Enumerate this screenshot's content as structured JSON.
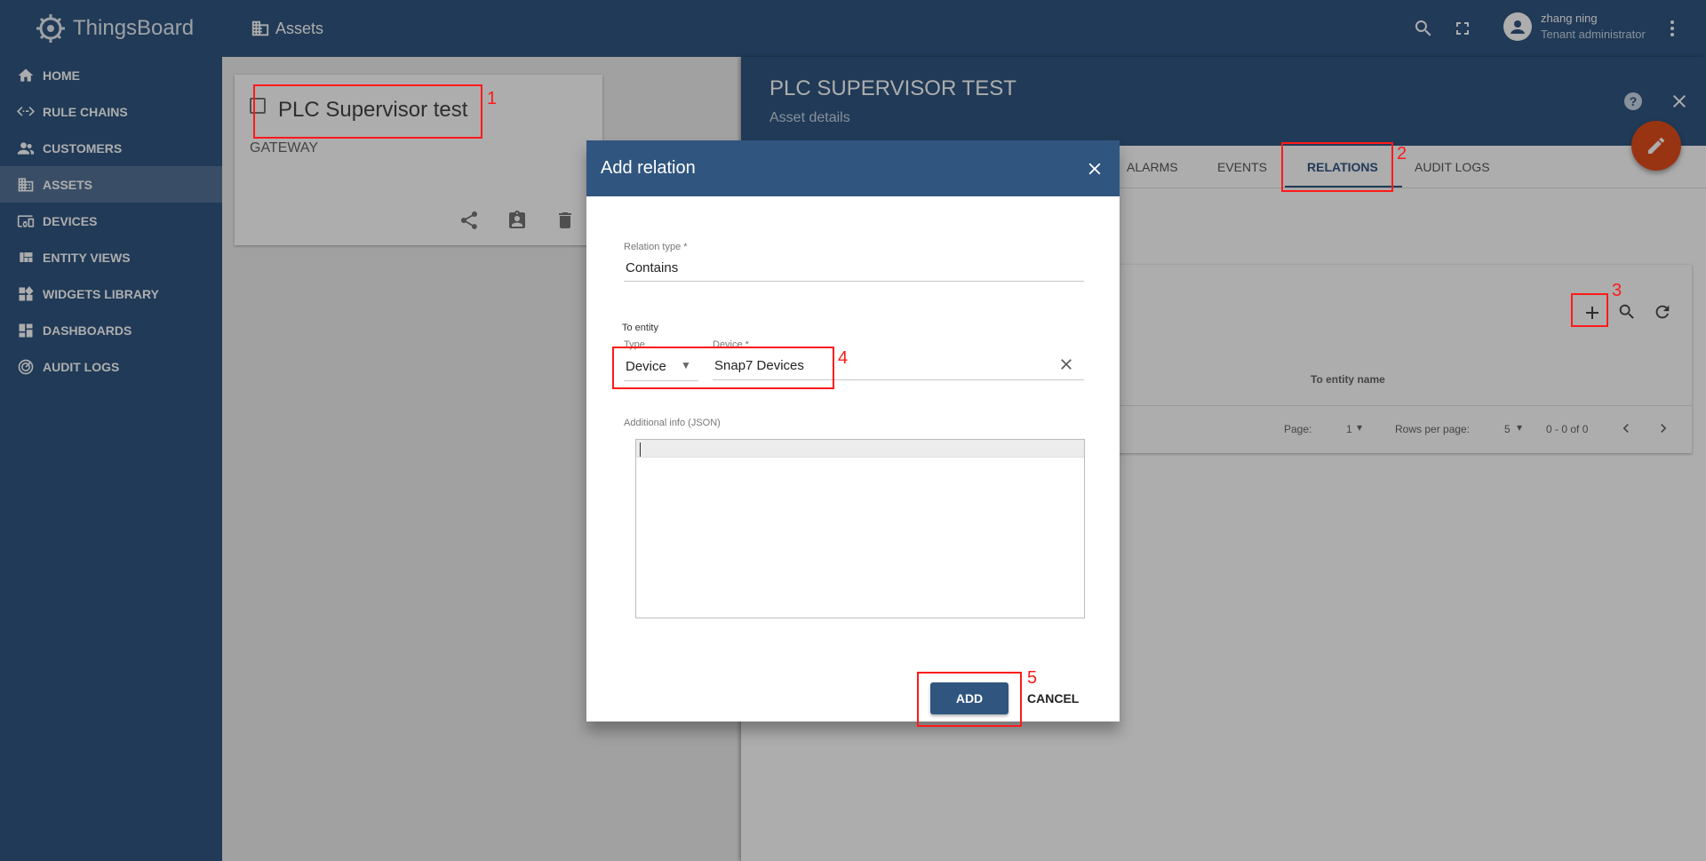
{
  "app": {
    "name": "ThingsBoard"
  },
  "sidebar": {
    "items": [
      {
        "label": "HOME",
        "icon": "home-icon"
      },
      {
        "label": "RULE CHAINS",
        "icon": "settings-ethernet-icon"
      },
      {
        "label": "CUSTOMERS",
        "icon": "supervisor-account-icon"
      },
      {
        "label": "ASSETS",
        "icon": "domain-icon",
        "active": true
      },
      {
        "label": "DEVICES",
        "icon": "devices-other-icon"
      },
      {
        "label": "ENTITY VIEWS",
        "icon": "view-quilt-icon"
      },
      {
        "label": "WIDGETS LIBRARY",
        "icon": "widgets-icon"
      },
      {
        "label": "DASHBOARDS",
        "icon": "dashboards-icon"
      },
      {
        "label": "AUDIT LOGS",
        "icon": "track-changes-icon"
      }
    ]
  },
  "header": {
    "breadcrumb": "Assets",
    "user_name": "zhang ning",
    "user_role": "Tenant administrator"
  },
  "asset_card": {
    "title": "PLC Supervisor test",
    "type": "GATEWAY"
  },
  "details": {
    "title": "PLC SUPERVISOR TEST",
    "subtitle": "Asset details",
    "tabs": [
      "ALARMS",
      "EVENTS",
      "RELATIONS",
      "AUDIT LOGS"
    ],
    "active_tab": "RELATIONS",
    "relations_table": {
      "column": "To entity name",
      "page_label": "Page:",
      "page_value": "1",
      "rows_label": "Rows per page:",
      "rows_value": "5",
      "range": "0 - 0 of 0"
    }
  },
  "dialog": {
    "title": "Add relation",
    "relation_type_label": "Relation type *",
    "relation_type_value": "Contains",
    "to_entity_label": "To entity",
    "type_label": "Type",
    "type_value": "Device",
    "device_label": "Device *",
    "device_value": "Snap7 Devices",
    "additional_info_label": "Additional info (JSON)",
    "add_button": "ADD",
    "cancel_button": "CANCEL"
  },
  "annotations": [
    "1",
    "2",
    "3",
    "4",
    "5"
  ],
  "colors": {
    "primary": "#305680",
    "accent": "#e24d1c",
    "annotation": "#ff1a1a"
  }
}
